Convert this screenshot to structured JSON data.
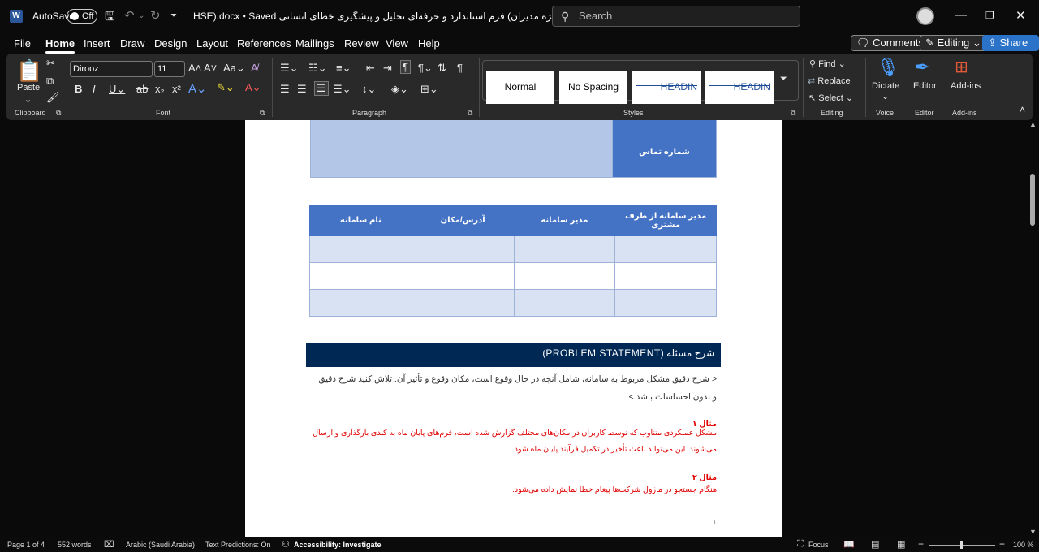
{
  "titlebar": {
    "autosave_label": "AutoSave",
    "autosave_state": "Off",
    "doc_title": "HSE).docx • Saved ویژه مدیران) فرم استاندارد و حرفه‌ای تحلیل و پیشگیری خطای انسانی",
    "search_placeholder": "Search"
  },
  "menu": {
    "items": [
      "File",
      "Home",
      "Insert",
      "Draw",
      "Design",
      "Layout",
      "References",
      "Mailings",
      "Review",
      "View",
      "Help"
    ],
    "active": "Home",
    "comments": "Comments",
    "editing": "Editing",
    "share": "Share"
  },
  "ribbon": {
    "clipboard": {
      "paste": "Paste",
      "label": "Clipboard"
    },
    "font": {
      "name": "Dirooz",
      "size": "11",
      "label": "Font"
    },
    "paragraph": {
      "label": "Paragraph"
    },
    "styles": {
      "label": "Styles",
      "cards": [
        "Normal",
        "No Spacing",
        "HEADIN",
        "HEADIN"
      ]
    },
    "editing": {
      "find": "Find",
      "replace": "Replace",
      "select": "Select",
      "label": "Editing"
    },
    "voice": {
      "dictate": "Dictate",
      "label": "Voice"
    },
    "editor": {
      "name": "Editor",
      "label": "Editor"
    },
    "addins": {
      "name": "Add-ins",
      "label": "Add-ins"
    }
  },
  "document": {
    "table1": {
      "label": "شماره تماس"
    },
    "table2": {
      "headers": [
        "مدیر سامانه از طرف مشتری",
        "مدیر سامانه",
        "آدرس/مکان",
        "نام سامانه"
      ]
    },
    "section_heading": "شرح مسئله (PROBLEM STATEMENT)",
    "instruction_line1": "< شرح دقیق مشکل مربوط به سامانه، شامل آنچه در حال وقوع است، مکان وقوع و تأثیر آن. تلاش کنید شرح دقیق",
    "instruction_line2": "و بدون احساسات باشد.>",
    "example1_title": "مثال ۱",
    "example1_line1": "مشکل عملکردی متناوب که توسط کاربران در مکان‌های مختلف گزارش شده است، فرم‌های پایان ماه به کندی بارگذاری و ارسال",
    "example1_line2": "می‌شوند. این می‌تواند باعث تأخیر در تکمیل فرآیند پایان ماه شود.",
    "example2_title": "مثال ۲",
    "example2_line1": "هنگام جستجو در ماژول شرکت‌ها پیغام خطا نمایش داده می‌شود.",
    "page_number": "۱"
  },
  "statusbar": {
    "page": "Page 1 of 4",
    "words": "552 words",
    "language": "Arabic (Saudi Arabia)",
    "predictions": "Text Predictions: On",
    "accessibility": "Accessibility: Investigate",
    "focus": "Focus",
    "zoom": "100 %"
  }
}
